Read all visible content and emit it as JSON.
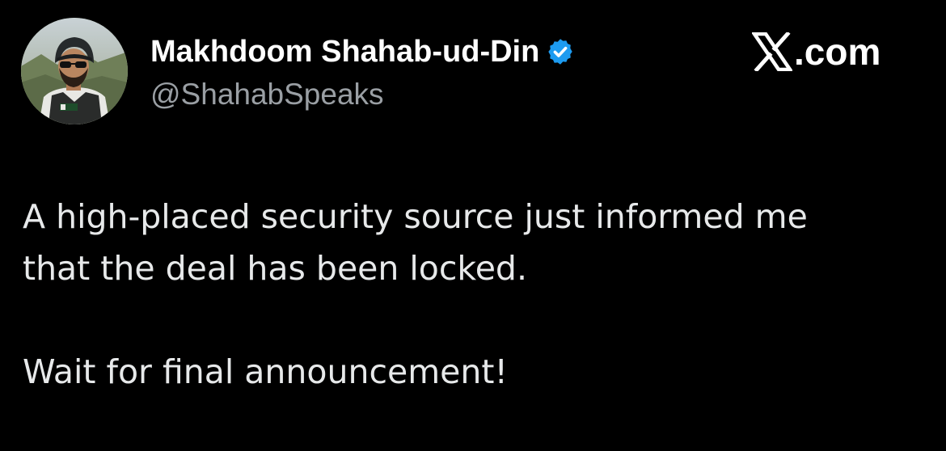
{
  "author": {
    "display_name": "Makhdoom Shahab-ud-Din",
    "handle": "@ShahabSpeaks",
    "verified": true,
    "verified_color": "#1d9bf0",
    "avatar_icon": "profile-photo-helmet-vest"
  },
  "brand": {
    "icon": "x-logo-icon",
    "text": ".com"
  },
  "tweet": {
    "paragraphs": [
      "A high-placed security source just informed me\nthat the deal has been locked.",
      "Wait for final announcement!"
    ]
  },
  "colors": {
    "background": "#000000",
    "text_primary": "#e7e9ea",
    "text_secondary": "#9a9fa4"
  }
}
